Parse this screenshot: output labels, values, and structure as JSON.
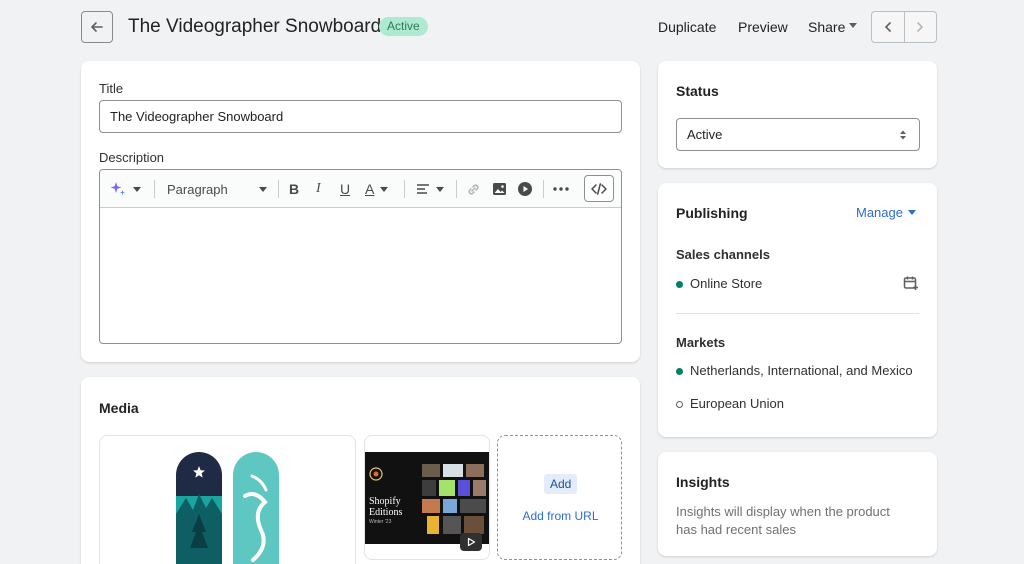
{
  "header": {
    "title": "The Videographer Snowboard",
    "status_badge": "Active",
    "actions": {
      "duplicate": "Duplicate",
      "preview": "Preview",
      "share": "Share"
    }
  },
  "product_card": {
    "title_label": "Title",
    "title_value": "The Videographer Snowboard",
    "description_label": "Description",
    "format_select": "Paragraph"
  },
  "media": {
    "heading": "Media",
    "add_button": "Add",
    "add_from_url": "Add from URL",
    "video_thumb_text": {
      "line1": "Shopify",
      "line2": "Editions",
      "line3": "Winter '23"
    }
  },
  "status_card": {
    "heading": "Status",
    "value": "Active"
  },
  "publishing": {
    "heading": "Publishing",
    "manage": "Manage",
    "sales_channels_label": "Sales channels",
    "channels": [
      "Online Store"
    ],
    "markets_label": "Markets",
    "markets": [
      {
        "name": "Netherlands, International, and Mexico",
        "state": "active"
      },
      {
        "name": "European Union",
        "state": "inactive"
      }
    ]
  },
  "insights": {
    "heading": "Insights",
    "text": "Insights will display when the product has had recent sales"
  },
  "colors": {
    "accent_green": "#008060",
    "badge_bg": "#aee9d1",
    "link_blue": "#2c6ecb",
    "ai_purple": "#7b61ff"
  }
}
